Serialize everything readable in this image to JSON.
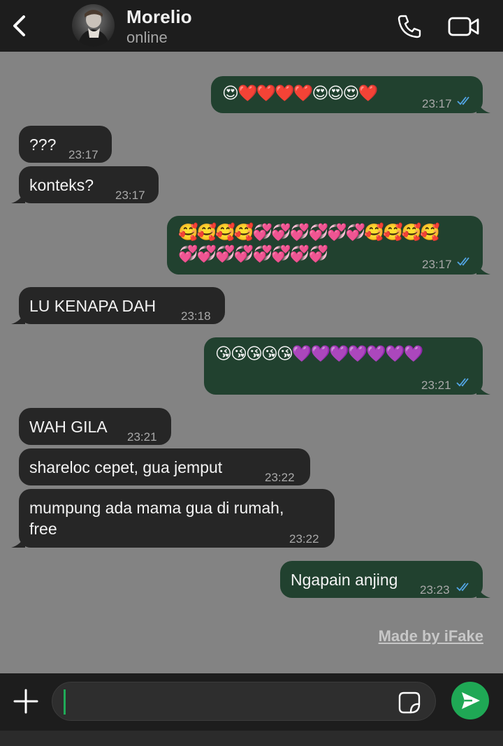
{
  "header": {
    "contact_name": "Morelio",
    "status": "online"
  },
  "messages": [
    {
      "dir": "out",
      "emoji_lines": [
        "😍❤️❤️❤️❤️😍😍😍❤️"
      ],
      "time": "23:17",
      "read": true
    },
    {
      "dir": "in",
      "text": "???",
      "time": "23:17"
    },
    {
      "dir": "in",
      "text": "konteks?",
      "time": "23:17"
    },
    {
      "dir": "out",
      "emoji_lines": [
        "🥰🥰🥰🥰💞💞💞💞💞💞🥰🥰🥰🥰",
        "💞💞💞💞💞💞💞💞"
      ],
      "time": "23:17",
      "read": true
    },
    {
      "dir": "in",
      "text": "LU KENAPA DAH",
      "time": "23:18"
    },
    {
      "dir": "out",
      "emoji_lines": [
        "😘😘😘😘😘💜💜💜💜💜💜💜"
      ],
      "time": "23:21",
      "read": true
    },
    {
      "dir": "in",
      "text": "WAH GILA",
      "time": "23:21"
    },
    {
      "dir": "in",
      "text": "shareloc cepet, gua jemput",
      "time": "23:22"
    },
    {
      "dir": "in",
      "text_lines": [
        "mumpung ada mama gua di rumah,",
        "free"
      ],
      "time": "23:22"
    },
    {
      "dir": "out",
      "text": "Ngapain anjing",
      "time": "23:23",
      "read": true
    }
  ],
  "watermark": "Made by iFake",
  "icons": {
    "back": "chevron-left-icon",
    "call": "phone-icon",
    "video": "video-camera-icon",
    "attach": "plus-icon",
    "sticker": "sticker-icon",
    "send": "send-icon",
    "read_receipt": "double-check-icon"
  },
  "colors": {
    "chat_background": "#838383",
    "incoming_bubble": "#262626",
    "outgoing_bubble": "#21412f",
    "read_tick": "#53a6e6",
    "send_button": "#1fa855"
  }
}
